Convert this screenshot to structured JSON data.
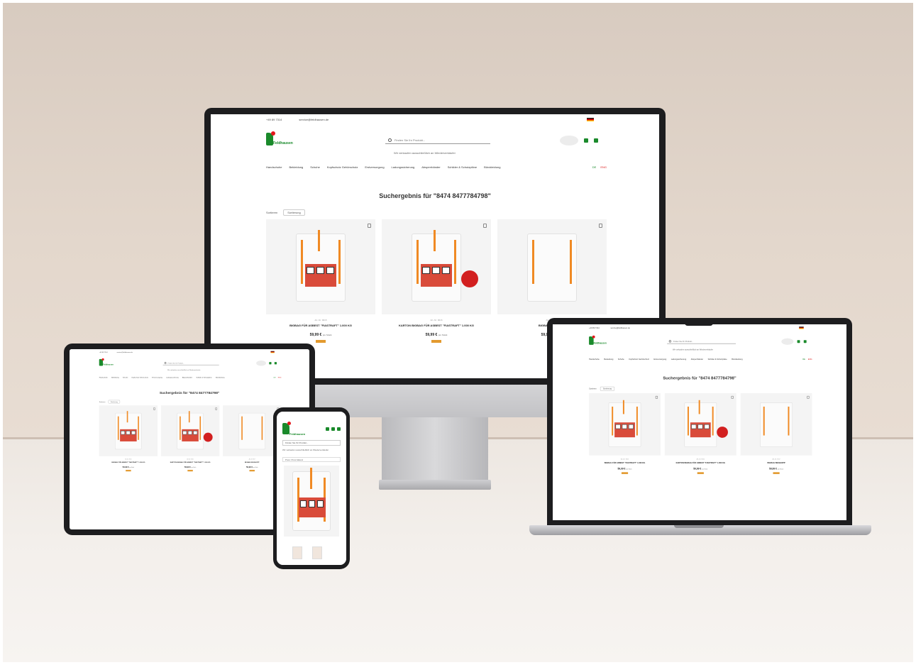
{
  "site": {
    "phone": "+49 89 7314",
    "email": "service@feldhausen.de",
    "brand": "Feldhausen",
    "search_placeholder": "Finden Sie Ihr Produkt...",
    "tagline": "Wir verkaufen ausschließlich an Wiederverkäufer",
    "nav": [
      "Handschuhe",
      "Bekleidung",
      "Schuhe",
      "Kopfschutz Gehörschutz",
      "Erstversorgung",
      "Ladungssicherung",
      "Absperrbänder",
      "Schilder & Schutzpläne",
      "Bürokleidung"
    ],
    "lang": {
      "de": "DE",
      "en": "ENG"
    },
    "results_title": "Suchergebnis für \"8474 8477784798\"",
    "filter": {
      "label": "Sortieren",
      "value": "Sortierung"
    },
    "products": [
      {
        "art": "Art.-Nr. 9015",
        "name": "BIGBAG FÜR ASBEST \"FIASTRAFT\" 1.000 KG",
        "price": "59,99 €",
        "unit": "pro Stück"
      },
      {
        "art": "Art.-Nr. 9016",
        "name": "KARTON BIGBAG FÜR ASBEST \"FIASTRAFT\" 1.000 KG",
        "price": "59,99 €",
        "unit": "pro Stück"
      },
      {
        "art": "Art.-Nr. 9017",
        "name": "BIGBAG BIGSHOPP",
        "price": "59,99 €",
        "unit": "pro Stück"
      }
    ]
  },
  "phone_site": {
    "search_placeholder": "Finden Sie Ihr Produkt...",
    "tagline": "Wir verkaufen ausschließlich an Wiederverkäufer",
    "sort": "Preis: Preis fallend"
  },
  "colors": {
    "brand_green": "#1a8a2b",
    "brand_red": "#e3171c",
    "strap_orange": "#f08a24"
  }
}
